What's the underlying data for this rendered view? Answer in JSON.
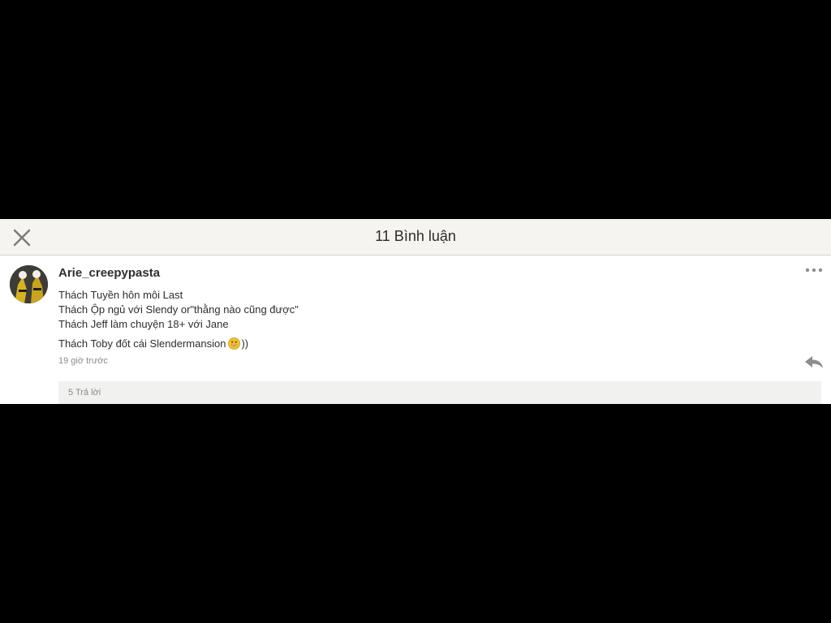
{
  "header": {
    "title": "11 Bình luận",
    "close_icon": "close-icon"
  },
  "comment": {
    "author": "Arie_creepypasta",
    "avatar": "avatar-image",
    "lines": [
      "Thách Tuyền hôn môi Last",
      "Thách Ộp ngủ với Slendy or\"thằng nào cũng được\"",
      "Thách Jeff làm chuyện 18+ với Jane",
      "Thách Toby đốt cái Slendermansion"
    ],
    "emoji": "grinning-emoji",
    "trailing_text": "))",
    "timestamp": "19 giờ trước",
    "more_icon": "more-options-icon",
    "reply_icon": "reply-icon",
    "replies_label": "5 Trả lời"
  },
  "colors": {
    "header_bg": "#f5f4f0",
    "text": "#2e2e2e",
    "muted": "#8a8a8a",
    "icon": "#8d8d8d",
    "replies_bg": "#f1f1f0"
  }
}
